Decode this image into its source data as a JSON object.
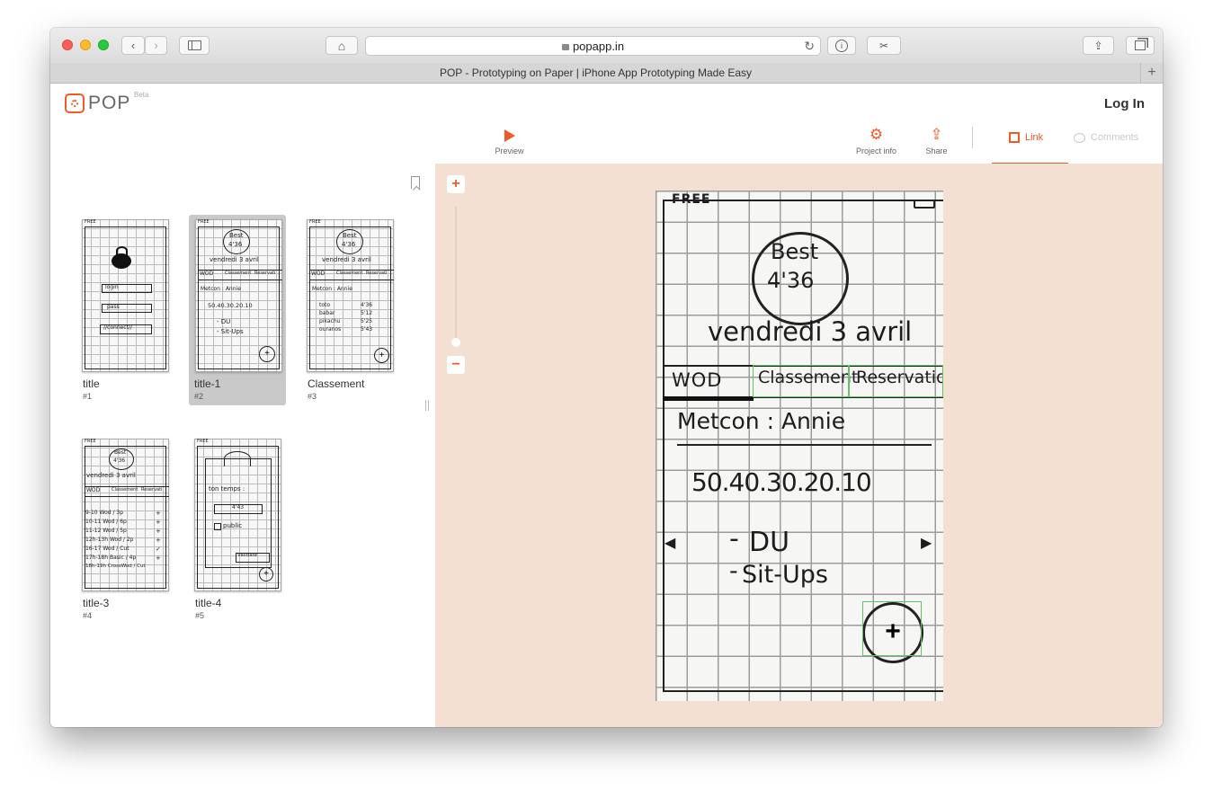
{
  "browser": {
    "url": "popapp.in",
    "tab_title": "POP - Prototyping on Paper | iPhone App Prototyping Made Easy"
  },
  "colors": {
    "accent": "#f05a28",
    "canvas_bg": "#f4e0d3",
    "hotspot": "#5ec65e"
  },
  "header": {
    "logo_text": "POP",
    "beta_label": "Beta",
    "login_label": "Log In",
    "preview_label": "Preview",
    "project_info_label": "Project info",
    "share_label": "Share",
    "link_tab_label": "Link",
    "comments_tab_label": "Comments"
  },
  "screens": [
    {
      "name": "title",
      "number": "#1",
      "selected": false
    },
    {
      "name": "title-1",
      "number": "#2",
      "selected": true
    },
    {
      "name": "Classement",
      "number": "#3",
      "selected": false
    },
    {
      "name": "title-3",
      "number": "#4",
      "selected": false
    },
    {
      "name": "title-4",
      "number": "#5",
      "selected": false
    }
  ],
  "zoom": {
    "plus": "+",
    "minus": "−"
  },
  "sketch": {
    "status": "FREE",
    "best_label": "Best",
    "best_time": "4'36",
    "date": "vendredi 3 avril",
    "tabs": [
      "WOD",
      "Classement",
      "Reservatio"
    ],
    "metcon": "Metcon : Annie",
    "reps": "50.40.30.20.10",
    "exercise_1": "DU",
    "exercise_2": "Sit-Ups",
    "fab": "+"
  },
  "thumbs": {
    "t1": {
      "status": "FREE",
      "login": "login",
      "pass": "pass",
      "connect": "//connect//"
    },
    "t2": {
      "status": "FREE",
      "best": "Best",
      "time": "4'36",
      "date": "vendredi 3 avril",
      "tabs": [
        "WOD",
        "Classement",
        "Reservati"
      ],
      "metcon": "Metcon : Annie",
      "reps": "50.40.30.20.10",
      "ex1": "- DU",
      "ex2": "- Sit-Ups"
    },
    "t3": {
      "status": "FREE",
      "best": "Best",
      "time": "4'36",
      "date": "vendredi 3 avril",
      "tabs": [
        "WOD",
        "Classement",
        "Reservati"
      ],
      "metcon": "Metcon : Annie",
      "rows": [
        [
          "toto",
          "4'36"
        ],
        [
          "babar",
          "5'12"
        ],
        [
          "pikachu",
          "5'25"
        ],
        [
          "ouranos",
          "5'43"
        ]
      ]
    },
    "t4": {
      "status": "FREE",
      "best": "Best",
      "time": "4'36",
      "date": "vendredi 3 avril",
      "tabs": [
        "WOD",
        "Classement",
        "Reservati"
      ],
      "rows": [
        "9-10 Wod / 3p",
        "10-11 Wod / 6p",
        "11-12 Wod / 5p",
        "12h-13h Wod / 2p",
        "16-17 Wod / Cut",
        "17h-18h Basic / 4p",
        "18h-19h CrossWod / Cut"
      ]
    },
    "t5": {
      "status": "FREE",
      "label": "ton temps :",
      "time": "4'43",
      "public": "public",
      "validate": "Validate"
    }
  }
}
